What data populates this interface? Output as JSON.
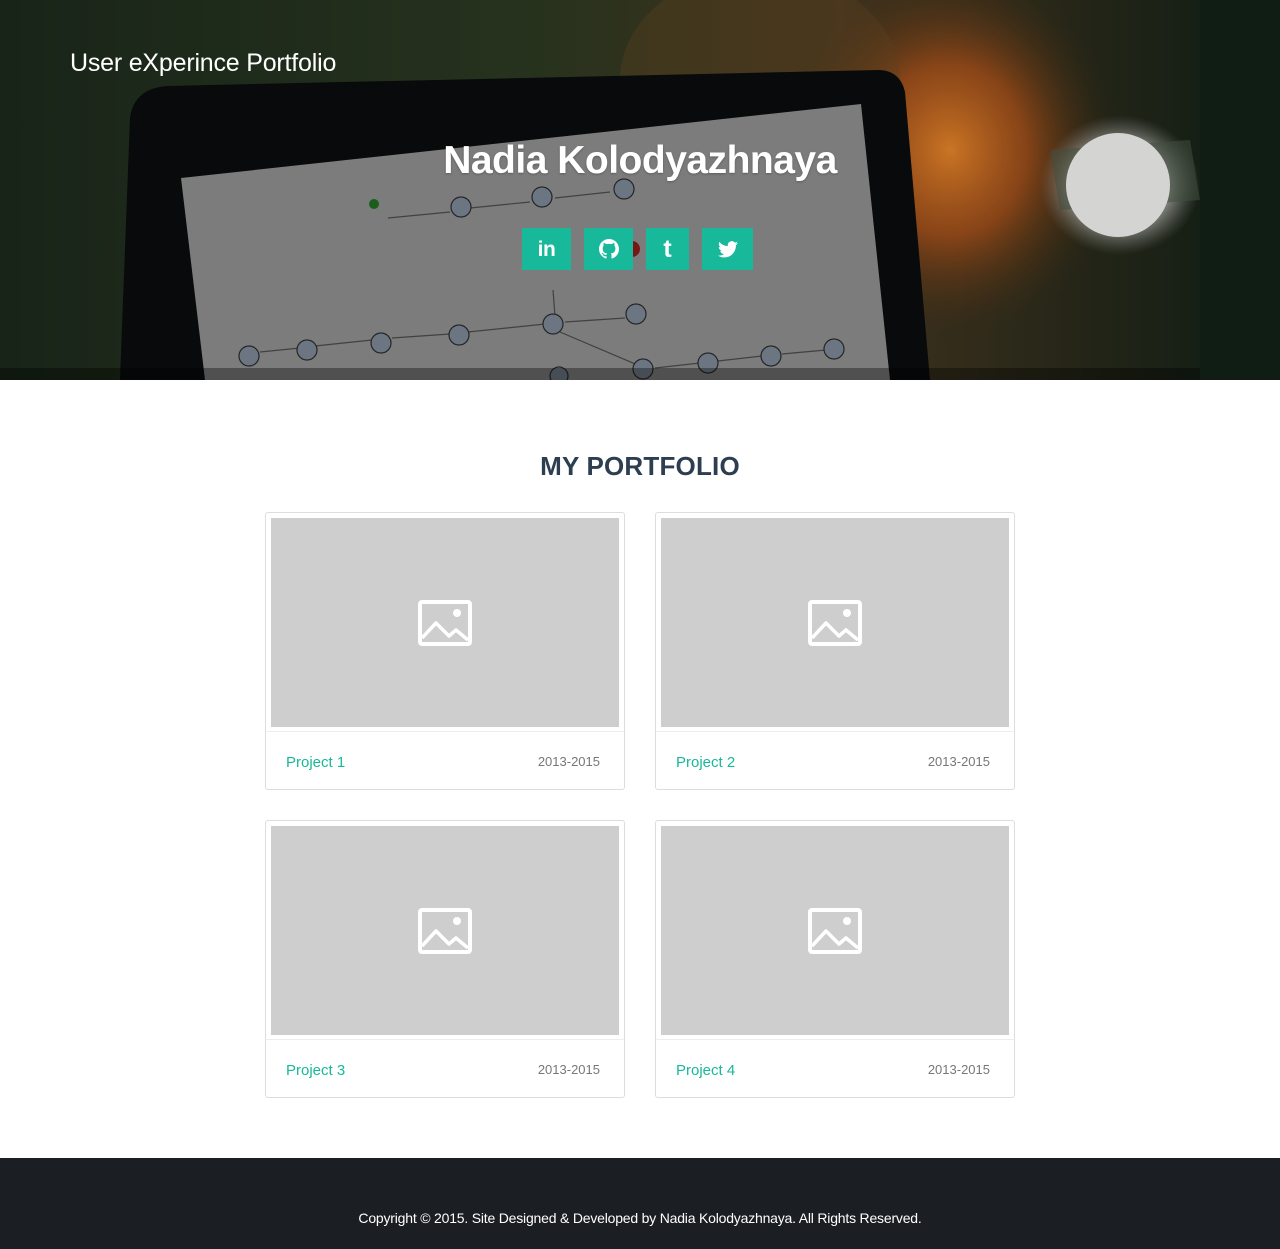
{
  "header": {
    "brand": "User eXperince Portfolio",
    "name": "Nadia Kolodyazhnaya",
    "background_image": "laptop-diagram-photo"
  },
  "social_links": [
    {
      "icon": "linkedin-icon",
      "glyph": "in"
    },
    {
      "icon": "github-icon"
    },
    {
      "icon": "tumblr-icon",
      "glyph": "t"
    },
    {
      "icon": "twitter-icon"
    }
  ],
  "portfolio": {
    "title": "MY PORTFOLIO",
    "projects": [
      {
        "title": "Project 1",
        "years": "2013-2015",
        "thumbnail_icon": "image-placeholder-icon"
      },
      {
        "title": "Project 2",
        "years": "2013-2015",
        "thumbnail_icon": "image-placeholder-icon"
      },
      {
        "title": "Project 3",
        "years": "2013-2015",
        "thumbnail_icon": "image-placeholder-icon"
      },
      {
        "title": "Project 4",
        "years": "2013-2015",
        "thumbnail_icon": "image-placeholder-icon"
      }
    ]
  },
  "footer": {
    "copyright": "Copyright © 2015. Site Designed & Developed by Nadia Kolodyazhnaya. All Rights Reserved."
  },
  "colors": {
    "accent": "#18b99a",
    "heading": "#2c3e50",
    "footer_bg": "#1b1e22",
    "thumbnail_bg": "#cecece"
  }
}
